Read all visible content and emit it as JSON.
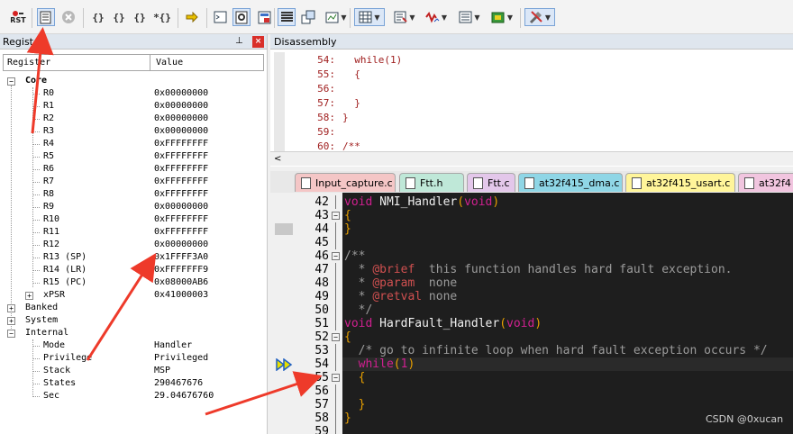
{
  "toolbar": {
    "rst_label": "RST",
    "icons": [
      "reset-icon",
      "registers-window-icon",
      "stop-icon",
      "step-into-icon",
      "step-over-icon",
      "step-out-icon",
      "run-to-cursor-icon",
      "show-next-statement-icon",
      "command-window-icon",
      "disassembly-window-icon",
      "symbols-window-icon",
      "registers-view-icon",
      "call-stack-icon",
      "watch-window-icon",
      "memory-window-icon",
      "serial-window-icon",
      "analysis-window-icon",
      "trace-window-icon",
      "system-viewer-icon",
      "toolbox-icon"
    ]
  },
  "registers_panel": {
    "title": "Registers",
    "pin": "ᵖ",
    "close": "×",
    "col_register": "Register",
    "col_value": "Value",
    "groups": [
      {
        "name": "Core",
        "expanded": true
      },
      {
        "name": "Banked",
        "expanded": false
      },
      {
        "name": "System",
        "expanded": false
      },
      {
        "name": "Internal",
        "expanded": true
      }
    ],
    "core": [
      {
        "name": "R0",
        "value": "0x00000000"
      },
      {
        "name": "R1",
        "value": "0x00000000"
      },
      {
        "name": "R2",
        "value": "0x00000000"
      },
      {
        "name": "R3",
        "value": "0x00000000"
      },
      {
        "name": "R4",
        "value": "0xFFFFFFFF"
      },
      {
        "name": "R5",
        "value": "0xFFFFFFFF"
      },
      {
        "name": "R6",
        "value": "0xFFFFFFFF"
      },
      {
        "name": "R7",
        "value": "0xFFFFFFFF"
      },
      {
        "name": "R8",
        "value": "0xFFFFFFFF"
      },
      {
        "name": "R9",
        "value": "0x00000000"
      },
      {
        "name": "R10",
        "value": "0xFFFFFFFF"
      },
      {
        "name": "R11",
        "value": "0xFFFFFFFF"
      },
      {
        "name": "R12",
        "value": "0x00000000"
      },
      {
        "name": "R13 (SP)",
        "value": "0x1FFFF3A0"
      },
      {
        "name": "R14 (LR)",
        "value": "0xFFFFFFF9"
      },
      {
        "name": "R15 (PC)",
        "value": "0x08000AB6"
      },
      {
        "name": "xPSR",
        "value": "0x41000003"
      }
    ],
    "internal": [
      {
        "name": "Mode",
        "value": "Handler"
      },
      {
        "name": "Privilege",
        "value": "Privileged"
      },
      {
        "name": "Stack",
        "value": "MSP"
      },
      {
        "name": "States",
        "value": "290467676"
      },
      {
        "name": "Sec",
        "value": "29.04676760"
      }
    ]
  },
  "disassembly": {
    "title": "Disassembly",
    "lines": [
      {
        "num": "54:",
        "text": "  while(1)"
      },
      {
        "num": "55:",
        "text": "  {"
      },
      {
        "num": "56:",
        "text": ""
      },
      {
        "num": "57:",
        "text": "  }"
      },
      {
        "num": "58:",
        "text": "}"
      },
      {
        "num": "59:",
        "text": ""
      },
      {
        "num": "60:",
        "text": "/**"
      }
    ],
    "scroll_left": "<"
  },
  "tabs": [
    {
      "label": "Input_capture.c",
      "color": "#f4c6c6"
    },
    {
      "label": "Ftt.h",
      "color": "#bfe8d8"
    },
    {
      "label": "Ftt.c",
      "color": "#e3c7ea"
    },
    {
      "label": "at32f415_dma.c",
      "color": "#8fd6e6"
    },
    {
      "label": "at32f415_usart.c",
      "color": "#fff59a"
    },
    {
      "label": "at32f4",
      "color": "#f1c5df"
    }
  ],
  "editor": {
    "lines": [
      {
        "num": "42",
        "fold": "",
        "text": "void NMI_Handler(void)"
      },
      {
        "num": "43",
        "fold": "−",
        "text": "{"
      },
      {
        "num": "44",
        "fold": "",
        "text": "}"
      },
      {
        "num": "45",
        "fold": "",
        "text": ""
      },
      {
        "num": "46",
        "fold": "−",
        "text": "/**"
      },
      {
        "num": "47",
        "fold": "",
        "text": "  * @brief  this function handles hard fault exception."
      },
      {
        "num": "48",
        "fold": "",
        "text": "  * @param  none"
      },
      {
        "num": "49",
        "fold": "",
        "text": "  * @retval none"
      },
      {
        "num": "50",
        "fold": "",
        "text": "  */"
      },
      {
        "num": "51",
        "fold": "",
        "text": "void HardFault_Handler(void)"
      },
      {
        "num": "52",
        "fold": "−",
        "text": "{"
      },
      {
        "num": "53",
        "fold": "",
        "text": "  /* go to infinite loop when hard fault exception occurs */"
      },
      {
        "num": "54",
        "fold": "",
        "text": "  while(1)"
      },
      {
        "num": "55",
        "fold": "−",
        "text": "  {"
      },
      {
        "num": "56",
        "fold": "",
        "text": ""
      },
      {
        "num": "57",
        "fold": "",
        "text": "  }"
      },
      {
        "num": "58",
        "fold": "",
        "text": "}"
      },
      {
        "num": "59",
        "fold": "",
        "text": ""
      }
    ]
  },
  "watermark": "CSDN @0xucan"
}
